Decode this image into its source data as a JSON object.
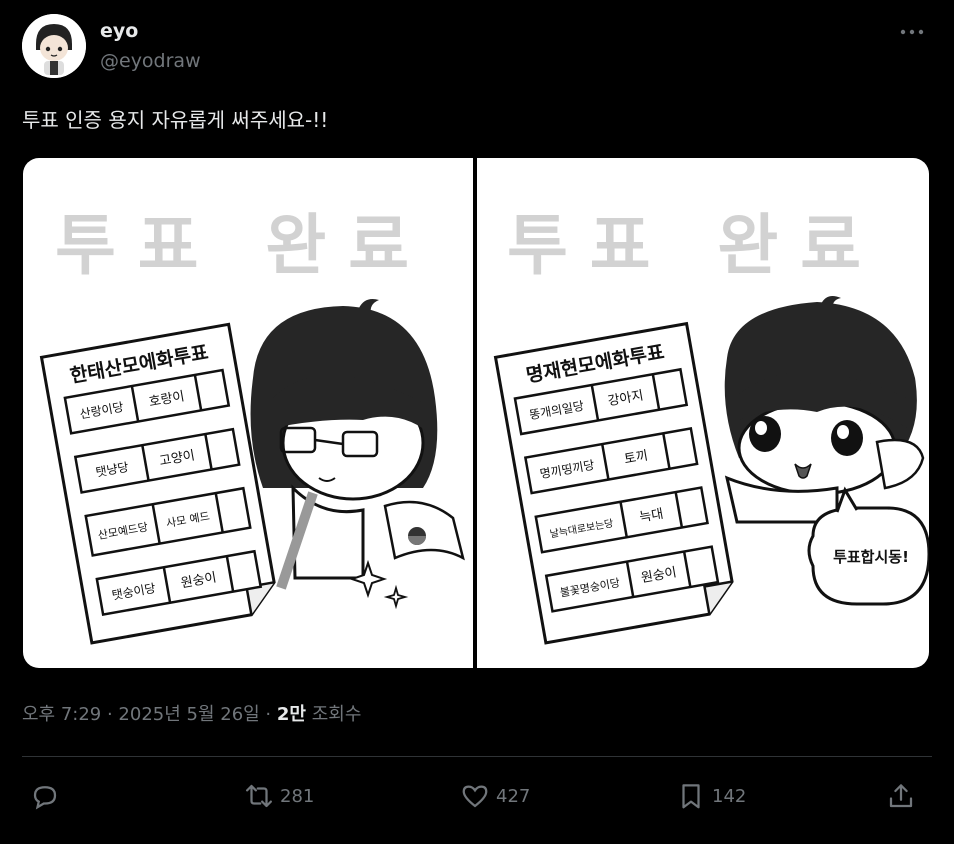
{
  "author": {
    "name": "eyo",
    "handle": "@eyodraw"
  },
  "tweet": {
    "text": "투표 인증 용지 자유롭게 써주세요-!!"
  },
  "panels": [
    {
      "title": "투표 완료",
      "ballot_heading": "한태산모에화투표",
      "rows": [
        {
          "option": "산랑이당",
          "name": "호랑이"
        },
        {
          "option": "탯냥당",
          "name": "고양이"
        },
        {
          "option": "산모예드당",
          "name": "사모 예드"
        },
        {
          "option": "탯숭이당",
          "name": "원숭이"
        }
      ]
    },
    {
      "title": "투표 완료",
      "ballot_heading": "명재현모에화투표",
      "rows": [
        {
          "option": "똥개의일당",
          "name": "강아지"
        },
        {
          "option": "명끼띵끼당",
          "name": "토끼"
        },
        {
          "option": "날늑대로보는당",
          "name": "늑대"
        },
        {
          "option": "불꽃명숭이당",
          "name": "원숭이"
        }
      ],
      "speech": "투표합시동!"
    }
  ],
  "meta": {
    "timestamp": "오후 7:29 · 2025년 5월 26일 ·",
    "views_count": "2만",
    "views_label": "조회수"
  },
  "actions": {
    "replies": "",
    "retweets": "281",
    "likes": "427",
    "bookmarks": "142"
  }
}
